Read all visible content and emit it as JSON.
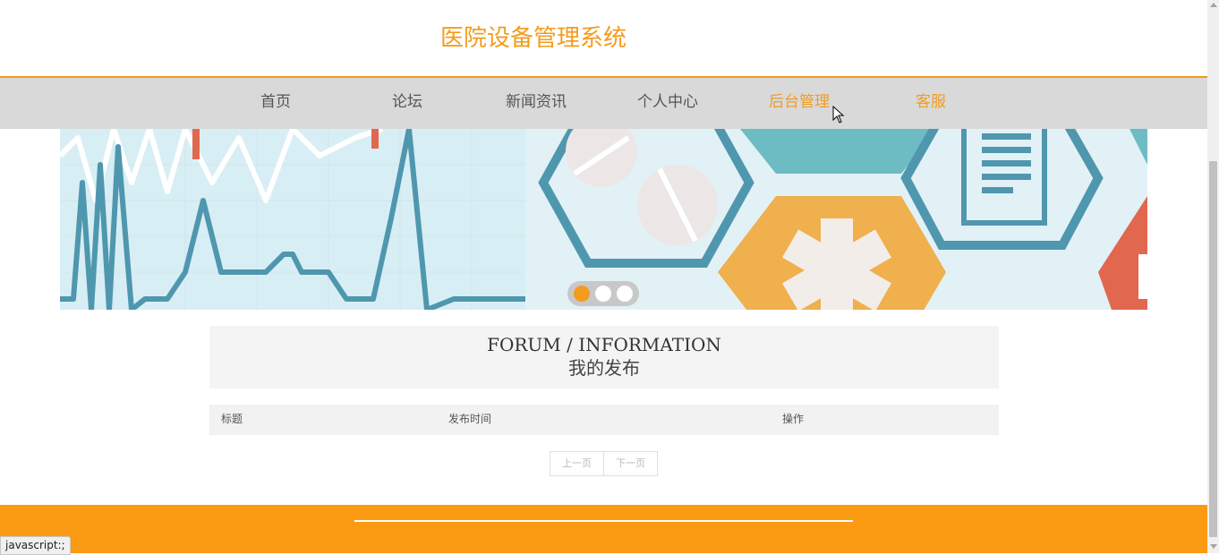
{
  "header": {
    "title": "医院设备管理系统"
  },
  "nav": {
    "items": [
      {
        "label": "首页"
      },
      {
        "label": "论坛"
      },
      {
        "label": "新闻资讯"
      },
      {
        "label": "个人中心"
      },
      {
        "label": "后台管理"
      },
      {
        "label": "客服"
      }
    ],
    "active_index": 4
  },
  "carousel": {
    "slide_count": 3,
    "active_slide": 1
  },
  "section": {
    "title_en": "FORUM / INFORMATION",
    "title_cn": "我的发布"
  },
  "table": {
    "columns": [
      "标题",
      "发布时间",
      "操作"
    ],
    "rows": []
  },
  "pagination": {
    "prev_label": "上一页",
    "next_label": "下一页"
  },
  "status_bar": {
    "text": "javascript:;"
  },
  "colors": {
    "accent": "#f39c1d",
    "footer": "#fb9a13",
    "nav_bg": "#d9d9d9"
  }
}
